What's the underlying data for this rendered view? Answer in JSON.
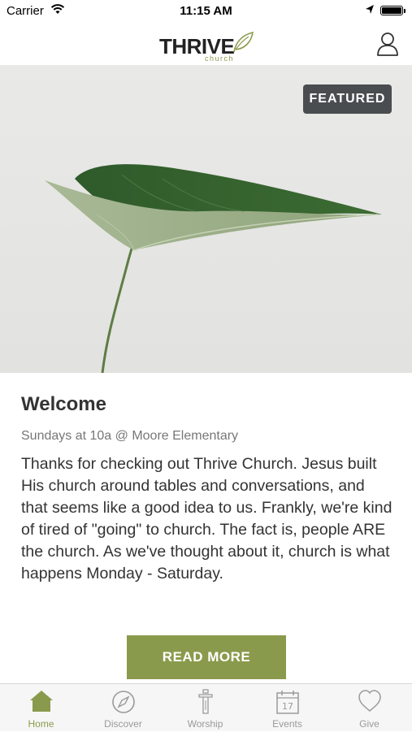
{
  "status_bar": {
    "carrier": "Carrier",
    "time": "11:15 AM"
  },
  "header": {
    "logo_text": "THRIVE",
    "logo_subtext": "church"
  },
  "hero": {
    "badge": "FEATURED"
  },
  "post": {
    "title": "Welcome",
    "subtitle": "Sundays at 10a @ Moore Elementary",
    "body": "Thanks for checking out Thrive Church. Jesus built His church around tables and conversations, and that seems like a good idea to us. Frankly, we're kind of tired of \"going\" to church. The fact is, people ARE the church. As we've thought about it, church is what happens Monday - Saturday.",
    "button_label": "READ MORE"
  },
  "tabs": [
    {
      "label": "Home",
      "icon": "home-icon",
      "active": true
    },
    {
      "label": "Discover",
      "icon": "compass-icon",
      "active": false
    },
    {
      "label": "Worship",
      "icon": "worship-icon",
      "active": false
    },
    {
      "label": "Events",
      "icon": "calendar-icon",
      "active": false,
      "icon_text": "17"
    },
    {
      "label": "Give",
      "icon": "heart-icon",
      "active": false
    }
  ],
  "colors": {
    "accent": "#8a9a4c",
    "badge_bg": "#4a4d4f",
    "tab_inactive": "#9a9a9a"
  }
}
